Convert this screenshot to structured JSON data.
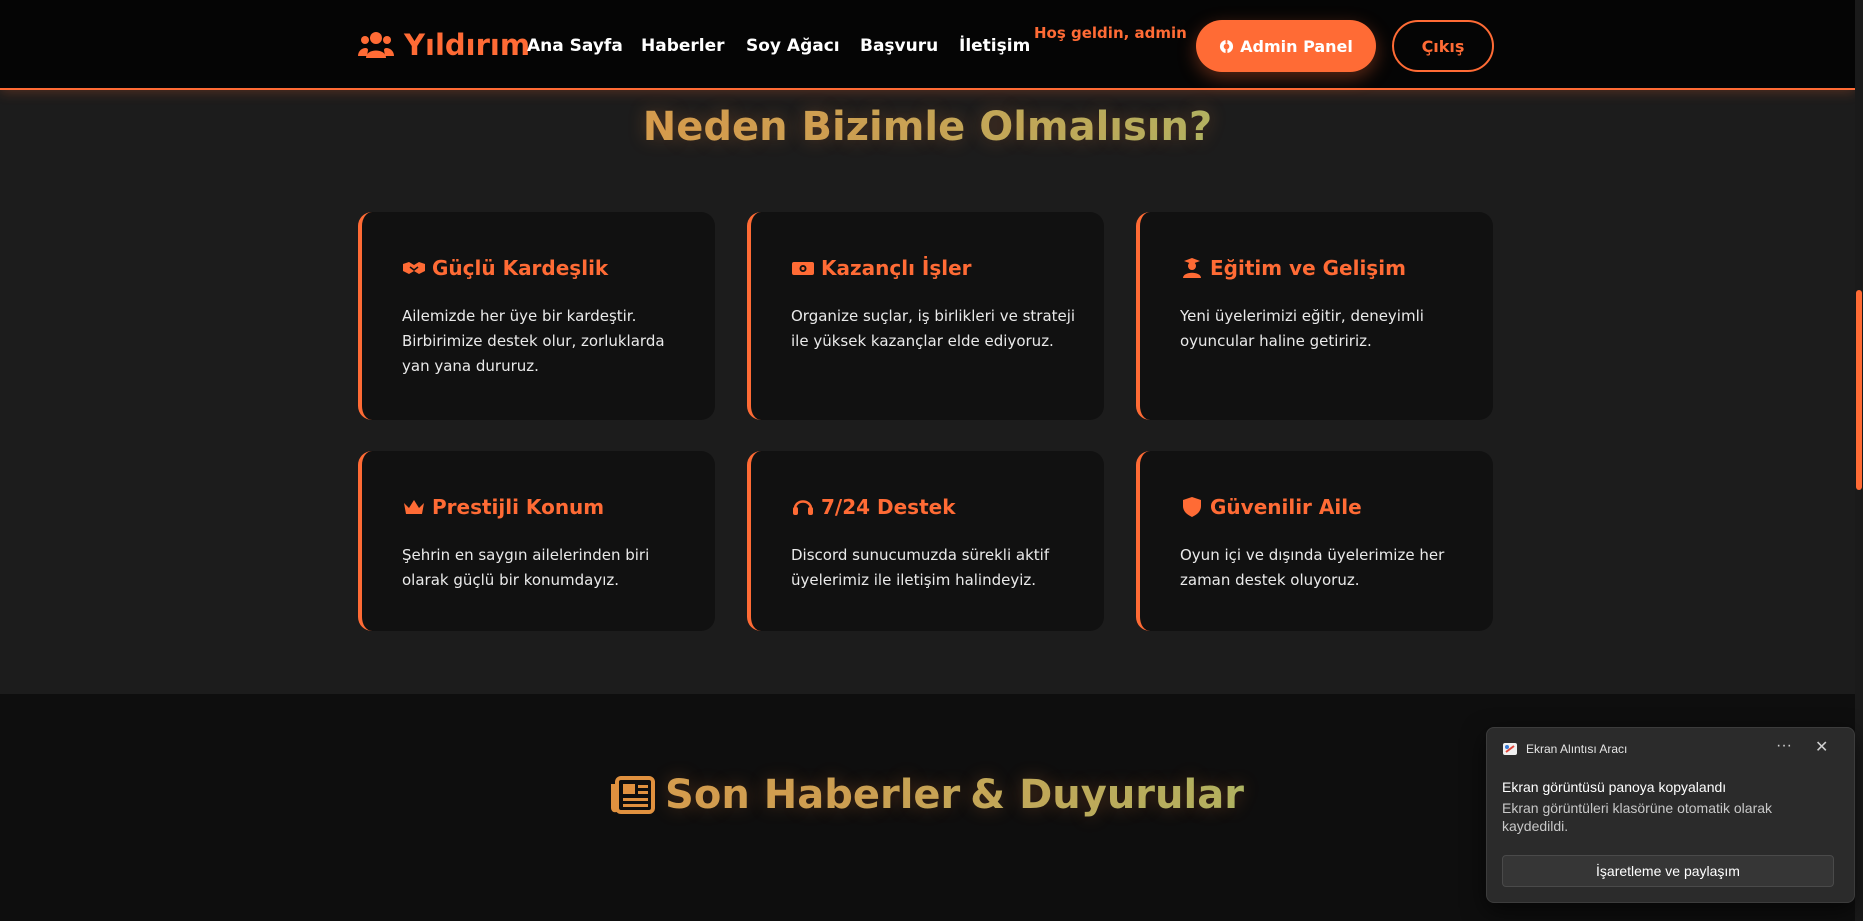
{
  "header": {
    "brand": "Yıldırım",
    "nav": [
      "Ana Sayfa",
      "Haberler",
      "Soy Ağacı",
      "Başvuru",
      "İletişim"
    ],
    "welcome": "Hoş geldin, admin",
    "admin_button": "Admin Panel",
    "logout_button": "Çıkış"
  },
  "features": {
    "title": "Neden Bizimle Olmalısın?",
    "cards": [
      {
        "icon": "handshake-icon",
        "title": "Güçlü Kardeşlik",
        "text": "Ailemizde her üye bir kardeştir. Birbirimize destek olur, zorluklarda yan yana dururuz."
      },
      {
        "icon": "money-icon",
        "title": "Kazançlı İşler",
        "text": "Organize suçlar, iş birlikleri ve strateji ile yüksek kazançlar elde ediyoruz."
      },
      {
        "icon": "graduate-icon",
        "title": "Eğitim ve Gelişim",
        "text": "Yeni üyelerimizi eğitir, deneyimli oyuncular haline getiririz."
      },
      {
        "icon": "crown-icon",
        "title": "Prestijli Konum",
        "text": "Şehrin en saygın ailelerinden biri olarak güçlü bir konumdayız."
      },
      {
        "icon": "headset-icon",
        "title": "7/24 Destek",
        "text": "Discord sunucumuzda sürekli aktif üyelerimiz ile iletişim halindeyiz."
      },
      {
        "icon": "shield-icon",
        "title": "Güvenilir Aile",
        "text": "Oyun içi ve dışında üyelerimize her zaman destek oluyoruz."
      }
    ]
  },
  "news": {
    "title_part1": "Son Haberler",
    "title_part2": "& Duyurular"
  },
  "toast": {
    "app_name": "Ekran Alıntısı Aracı",
    "more": "···",
    "close": "✕",
    "title": "Ekran görüntüsü panoya kopyalandı",
    "body": "Ekran görüntüleri klasörüne otomatik olarak kaydedildi.",
    "button": "İşaretleme ve paylaşım"
  },
  "colors": {
    "accent": "#ff6b35",
    "card_bg": "#111111",
    "page_bg": "#1c1c1c",
    "gradient_end": "#7ed67e"
  }
}
